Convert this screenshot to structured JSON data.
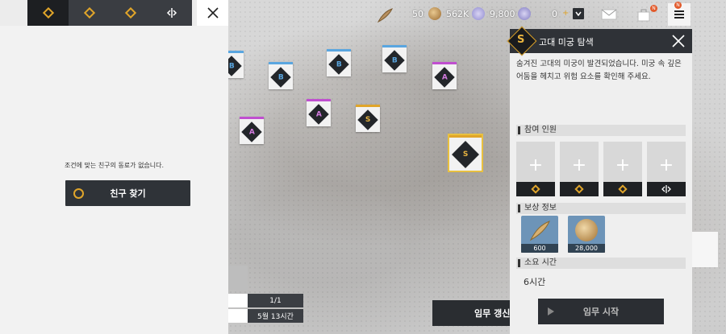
{
  "left_panel": {
    "tabs": [
      {
        "icon": "gold-emblem-icon",
        "active": true
      },
      {
        "icon": "gold-emblem-icon",
        "active": false
      },
      {
        "icon": "gold-emblem-icon",
        "active": false
      },
      {
        "icon": "split-arrow-icon",
        "active": false
      }
    ],
    "empty_message": "조건에 맞는 친구의 동료가 없습니다.",
    "find_friend_button": "친구 찾기"
  },
  "bottom_info": {
    "page": "1/1",
    "date": "5월 13시간",
    "renew_button": "임무 갱신"
  },
  "top_bar": {
    "stamina": "50",
    "gold": "562K",
    "gems": "9,800",
    "tickets": "0",
    "accent": "#e0a52a"
  },
  "map_markers": [
    {
      "grade": "B"
    },
    {
      "grade": "B"
    },
    {
      "grade": "B"
    },
    {
      "grade": "B"
    },
    {
      "grade": "A"
    },
    {
      "grade": "A"
    },
    {
      "grade": "A"
    },
    {
      "grade": "S"
    },
    {
      "grade": "S"
    }
  ],
  "mission": {
    "grade": "S",
    "title": "고대 미궁 탐색",
    "description": "숨겨진 고대의 미궁이 발견되었습니다. 미궁 속 깊은 어둠을 헤치고 위험 요소를 확인해 주세요.",
    "participants_label": "참여 인원",
    "rewards_label": "보상 정보",
    "rewards": [
      {
        "name": "feather-icon",
        "qty": "600"
      },
      {
        "name": "gold-coin-icon",
        "qty": "28,000"
      }
    ],
    "duration_label": "소요 시간",
    "duration": "6시간",
    "start_button": "임무 시작"
  }
}
